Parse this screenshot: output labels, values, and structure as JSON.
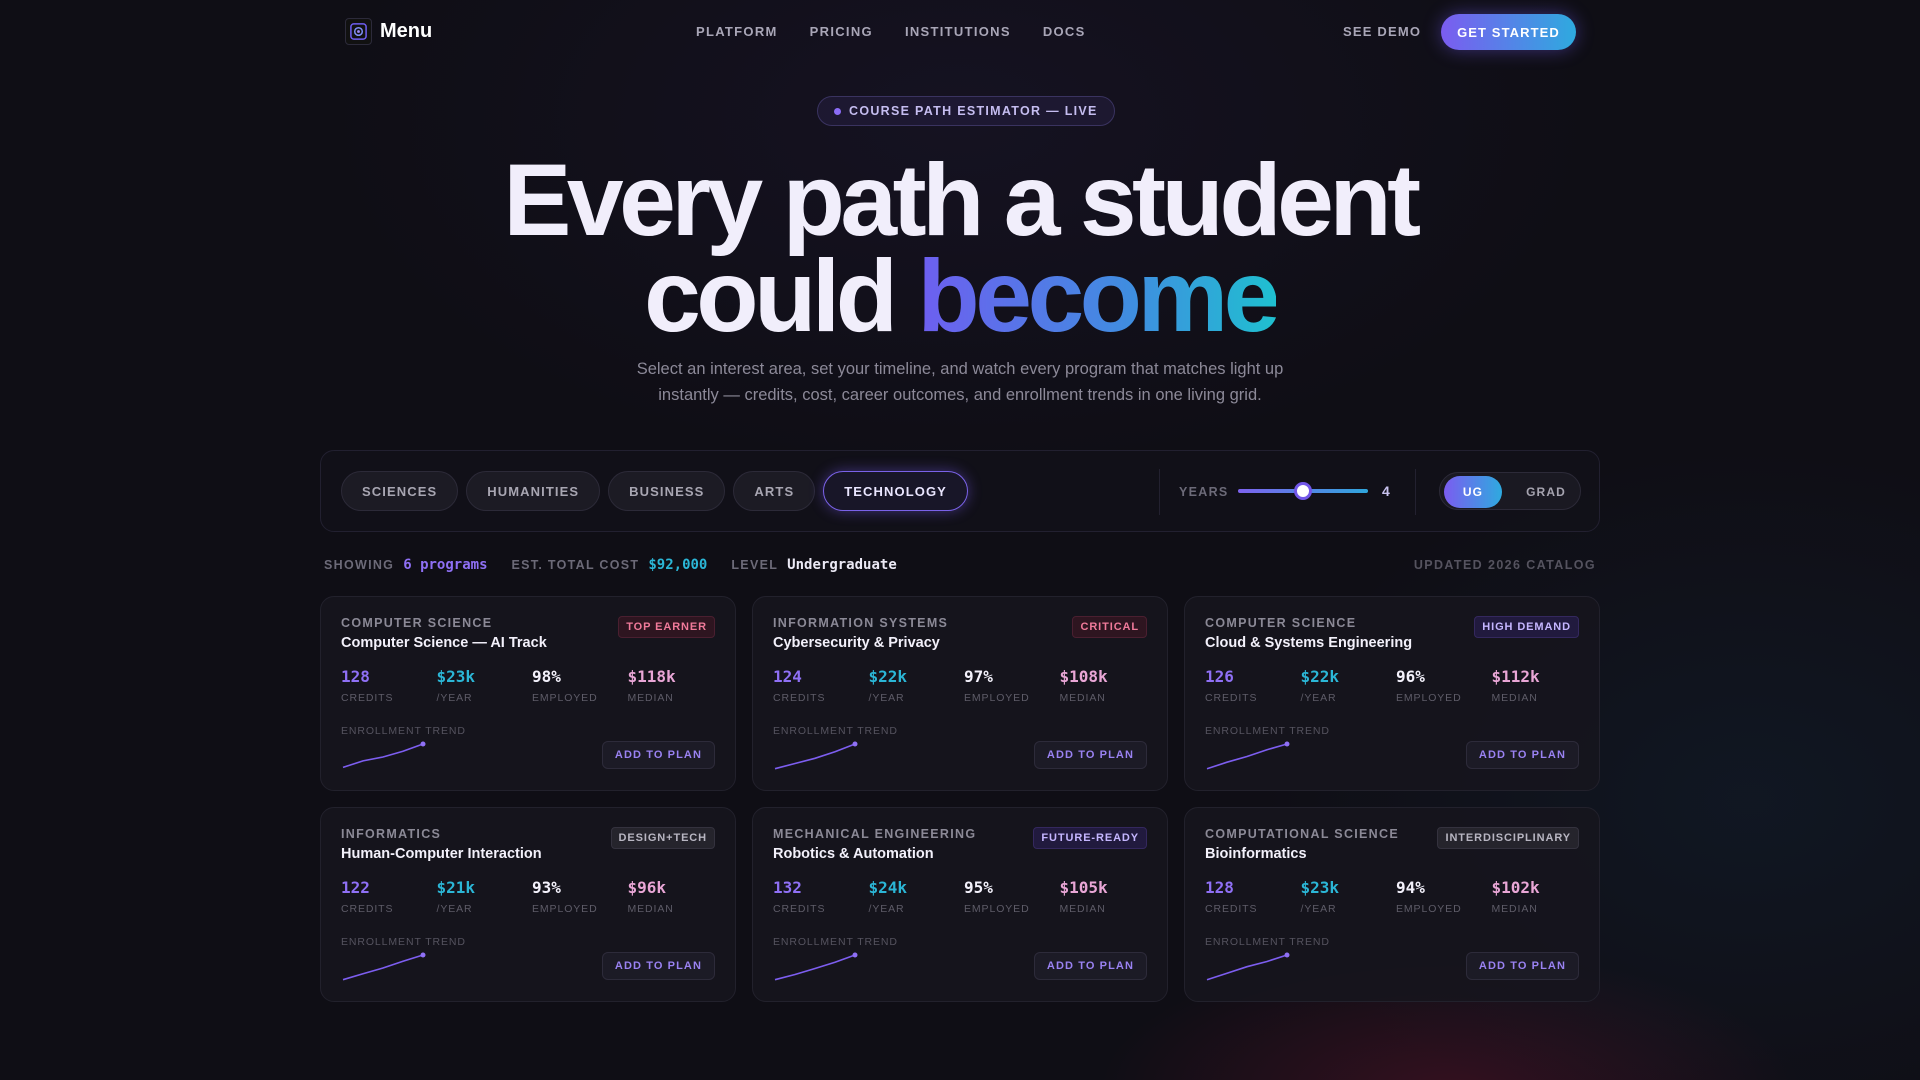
{
  "nav": {
    "brand": "Menu",
    "links": [
      "PLATFORM",
      "PRICING",
      "INSTITUTIONS",
      "DOCS"
    ],
    "see_demo": "SEE DEMO",
    "get_started": "GET STARTED"
  },
  "hero": {
    "pill": "COURSE PATH ESTIMATOR — LIVE",
    "title_line1": "Every path a student",
    "title_line2_plain": "could ",
    "title_line2_accent": "become",
    "subtitle": "Select an interest area, set your timeline, and watch every program that matches light up instantly — credits, cost, career outcomes, and enrollment trends in one living grid."
  },
  "filters": {
    "chips": [
      "SCIENCES",
      "HUMANITIES",
      "BUSINESS",
      "ARTS",
      "TECHNOLOGY"
    ],
    "active_chip": "TECHNOLOGY",
    "years_label": "YEARS",
    "years_value": "4",
    "years_fraction": 0.5,
    "level_options": [
      "UG",
      "GRAD"
    ],
    "level_selected": "UG"
  },
  "status": {
    "showing_label": "SHOWING",
    "showing_value": "6 programs",
    "cost_label": "EST. TOTAL COST",
    "cost_value": "$92,000",
    "level_label": "LEVEL",
    "level_value": "Undergraduate",
    "updated": "UPDATED 2026 CATALOG"
  },
  "colors": {
    "accent_purple": "#8f70f5",
    "accent_cyan": "#2bb6d6",
    "accent_pink": "#e9a6d6"
  },
  "cards": [
    {
      "category": "COMPUTER SCIENCE",
      "title": "Computer Science — AI Track",
      "badge": "TOP EARNER",
      "badge_style": "red",
      "credits": "128",
      "cost": "$23k",
      "employed": "98%",
      "median": "$118k",
      "trend": [
        0.1,
        0.35,
        0.5,
        0.72,
        1.0
      ],
      "action": "ADD TO PLAN"
    },
    {
      "category": "INFORMATION SYSTEMS",
      "title": "Cybersecurity & Privacy",
      "badge": "CRITICAL",
      "badge_style": "red",
      "credits": "124",
      "cost": "$22k",
      "employed": "97%",
      "median": "$108k",
      "trend": [
        0.05,
        0.25,
        0.45,
        0.7,
        1.0
      ],
      "action": "ADD TO PLAN"
    },
    {
      "category": "COMPUTER SCIENCE",
      "title": "Cloud & Systems Engineering",
      "badge": "HIGH DEMAND",
      "badge_style": "purple",
      "credits": "126",
      "cost": "$22k",
      "employed": "96%",
      "median": "$112k",
      "trend": [
        0.05,
        0.3,
        0.52,
        0.78,
        1.0
      ],
      "action": "ADD TO PLAN"
    },
    {
      "category": "INFORMATICS",
      "title": "Human-Computer Interaction",
      "badge": "DESIGN+TECH",
      "badge_style": "gray",
      "credits": "122",
      "cost": "$21k",
      "employed": "93%",
      "median": "$96k",
      "trend": [
        0.05,
        0.28,
        0.5,
        0.76,
        1.0
      ],
      "action": "ADD TO PLAN"
    },
    {
      "category": "MECHANICAL ENGINEERING",
      "title": "Robotics & Automation",
      "badge": "FUTURE-READY",
      "badge_style": "purple",
      "credits": "132",
      "cost": "$24k",
      "employed": "95%",
      "median": "$105k",
      "trend": [
        0.05,
        0.25,
        0.48,
        0.72,
        1.0
      ],
      "action": "ADD TO PLAN"
    },
    {
      "category": "COMPUTATIONAL SCIENCE",
      "title": "Bioinformatics",
      "badge": "INTERDISCIPLINARY",
      "badge_style": "gray",
      "credits": "128",
      "cost": "$23k",
      "employed": "94%",
      "median": "$102k",
      "trend": [
        0.05,
        0.3,
        0.55,
        0.75,
        1.0
      ],
      "action": "ADD TO PLAN"
    }
  ],
  "stat_labels": {
    "credits": "CREDITS",
    "cost": "/YEAR",
    "employed": "EMPLOYED",
    "median": "MEDIAN",
    "trend": "ENROLLMENT TREND"
  }
}
